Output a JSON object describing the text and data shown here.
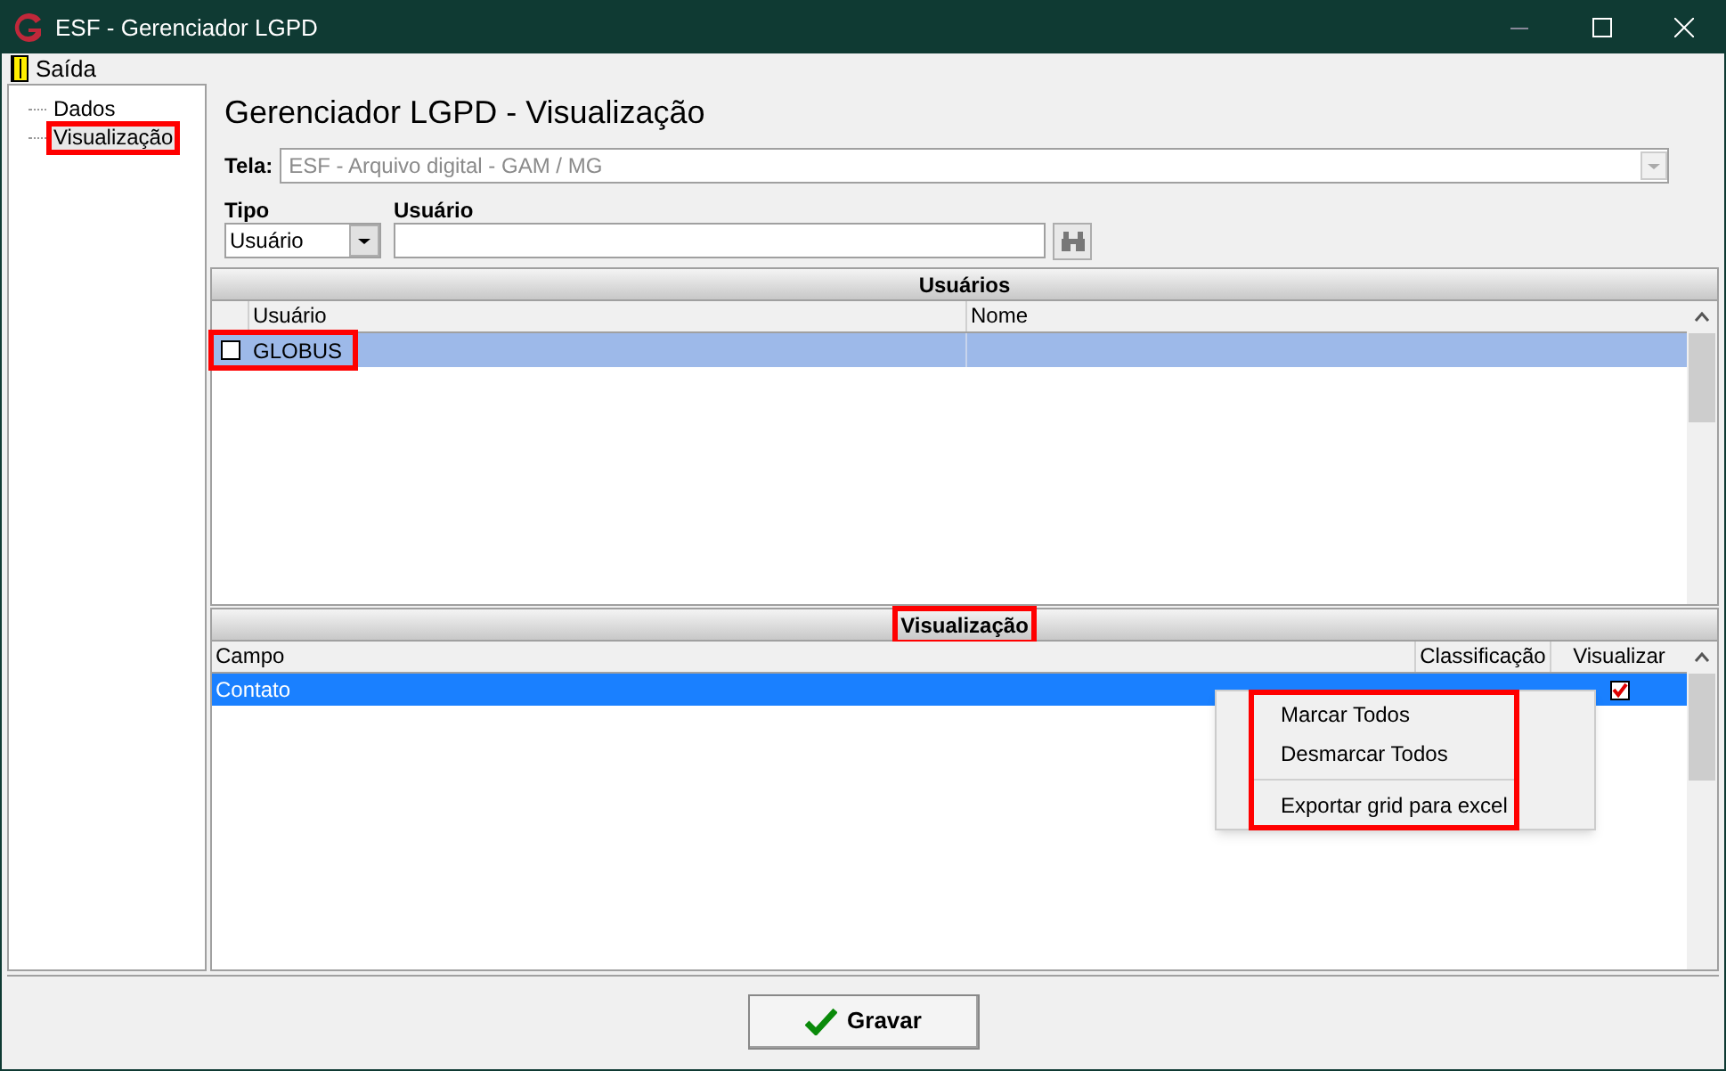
{
  "window": {
    "title": "ESF - Gerenciador LGPD"
  },
  "menu": [
    {
      "label": "Saída"
    }
  ],
  "tree": [
    {
      "label": "Dados",
      "selected": false,
      "annotated": false
    },
    {
      "label": "Visualização",
      "selected": true,
      "annotated": true
    }
  ],
  "heading": "Gerenciador LGPD - Visualização",
  "tela": {
    "label": "Tela:",
    "value": "ESF - Arquivo digital - GAM / MG",
    "disabled": true
  },
  "tipo": {
    "label": "Tipo",
    "value": "Usuário"
  },
  "usuario": {
    "label": "Usuário"
  },
  "usuarios_grid": {
    "title": "Usuários",
    "annotated": false,
    "columns": [
      "Usuário",
      "Nome"
    ],
    "rows": [
      {
        "usuario": "GLOBUS",
        "checked": false,
        "selected": true,
        "annotated": true
      }
    ]
  },
  "visualizacao_grid": {
    "title": "Visualização",
    "annotated": true,
    "columns": [
      "Campo",
      "Classificação",
      "Visualizar"
    ],
    "rows": [
      {
        "campo": "Contato",
        "visualizar": true,
        "selected": true
      }
    ]
  },
  "context_menu": {
    "annotated": true,
    "items": [
      {
        "kind": "item",
        "label": "Marcar Todos"
      },
      {
        "kind": "item",
        "label": "Desmarcar Todos"
      },
      {
        "kind": "separator"
      },
      {
        "kind": "item",
        "label": "Exportar grid para excel"
      }
    ]
  },
  "save_button": {
    "label": "Gravar"
  }
}
